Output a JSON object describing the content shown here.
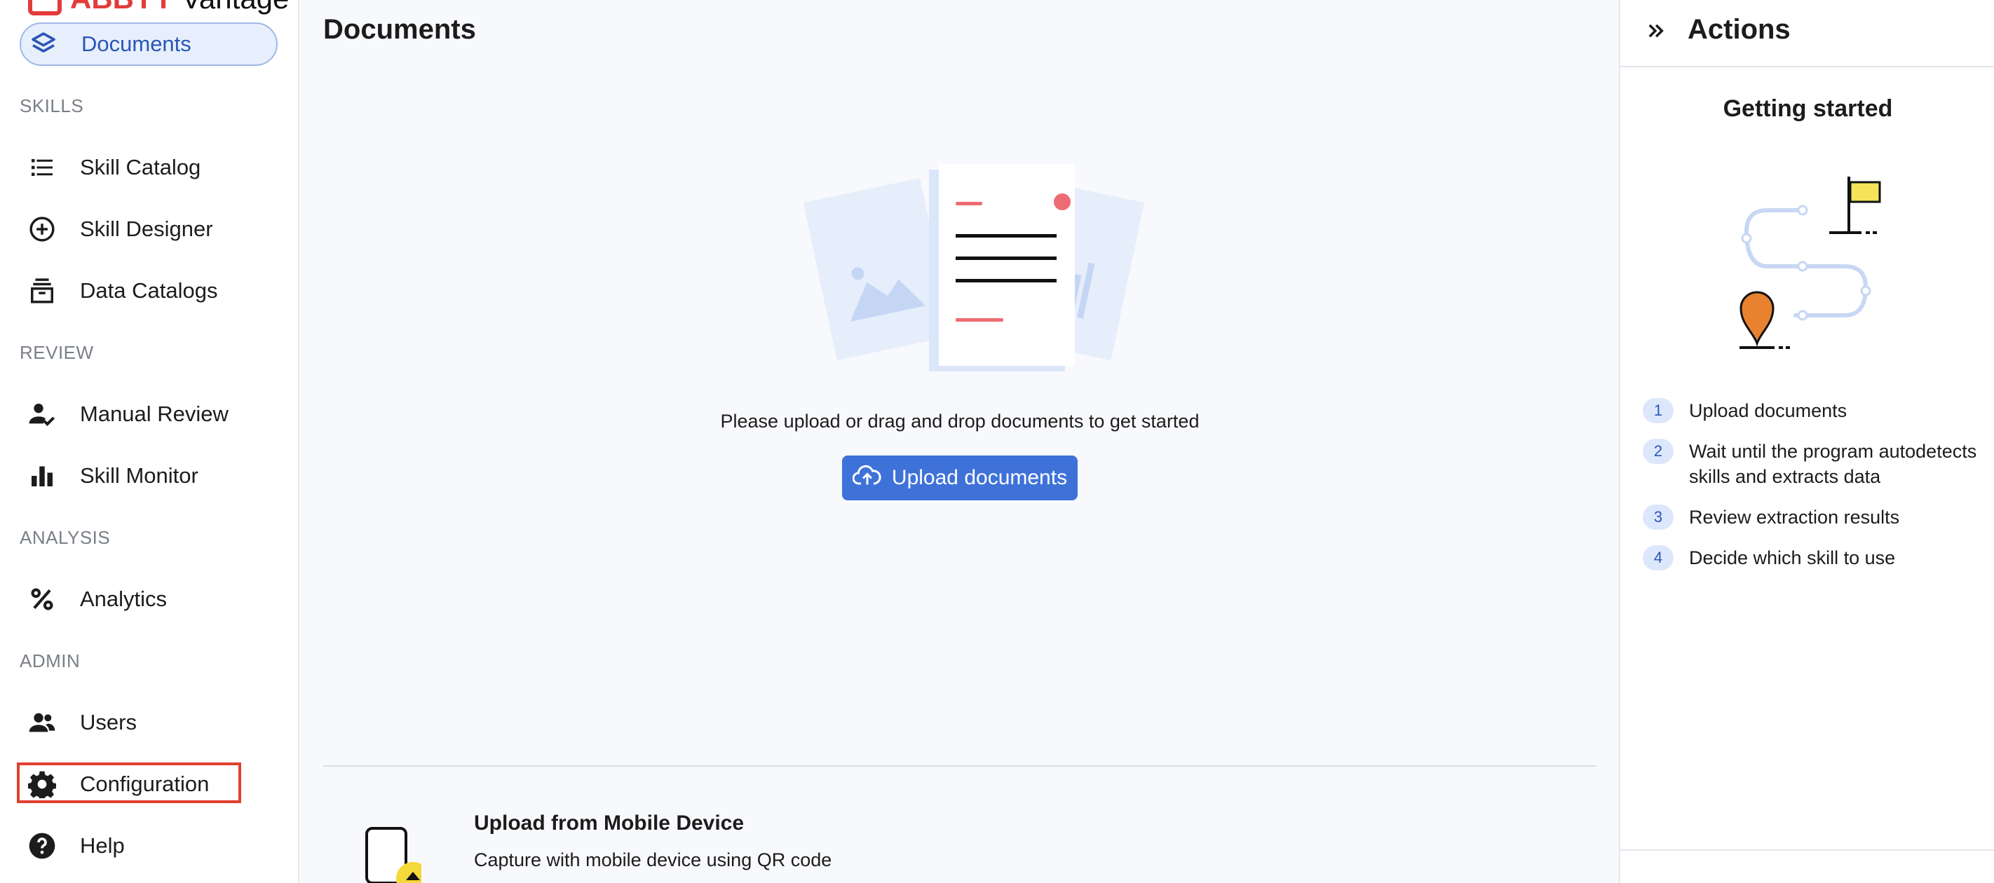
{
  "brand": {
    "abbyy": "ABBYY",
    "product": "Vantage"
  },
  "sidebar": {
    "active": {
      "label": "Documents",
      "icon": "layers-icon"
    },
    "sections": {
      "skills": "SKILLS",
      "review": "REVIEW",
      "analysis": "ANALYSIS",
      "admin": "ADMIN"
    },
    "items": {
      "skill_catalog": "Skill Catalog",
      "skill_designer": "Skill Designer",
      "data_catalogs": "Data Catalogs",
      "manual_review": "Manual Review",
      "skill_monitor": "Skill Monitor",
      "analytics": "Analytics",
      "users": "Users",
      "configuration": "Configuration",
      "help": "Help"
    }
  },
  "main": {
    "title": "Documents",
    "empty_text": "Please upload or drag and drop documents to get started",
    "upload_button": "Upload documents",
    "mobile": {
      "title": "Upload from Mobile Device",
      "subtitle": "Capture with mobile device using QR code"
    }
  },
  "actions": {
    "title": "Actions",
    "getting_started": "Getting started",
    "steps": [
      {
        "num": "1",
        "text": "Upload documents"
      },
      {
        "num": "2",
        "text": "Wait until the program autodetects skills and extracts data"
      },
      {
        "num": "3",
        "text": "Review extraction results"
      },
      {
        "num": "4",
        "text": "Decide which skill to use"
      }
    ]
  },
  "colors": {
    "accent": "#3f72d9",
    "brand_red": "#e33b3b",
    "highlight": "#e0402f",
    "active_bg": "#e8effc"
  }
}
